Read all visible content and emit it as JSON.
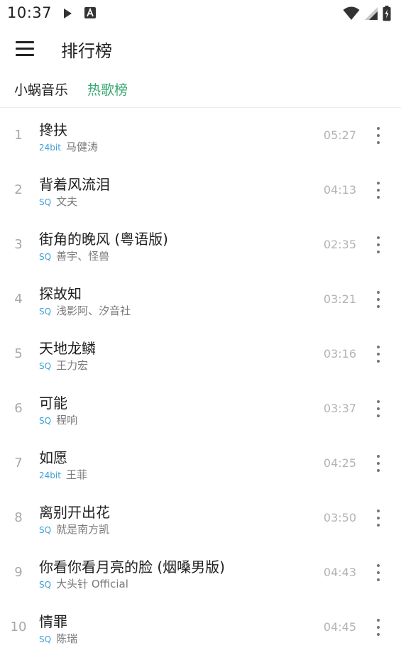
{
  "status_bar": {
    "time": "10:37",
    "icons": [
      "play-icon",
      "a-notification-icon",
      "wifi-icon",
      "signal-icon",
      "battery-icon"
    ]
  },
  "app_bar": {
    "menu_icon": "menu-icon",
    "title": "排行榜"
  },
  "tabs": {
    "source": "小蜗音乐",
    "active": "热歌榜",
    "active_color": "#3aa873"
  },
  "songs": [
    {
      "rank": "1",
      "title": "搀扶",
      "quality": "24bit",
      "artist": "马健涛",
      "duration": "05:27"
    },
    {
      "rank": "2",
      "title": "背着风流泪",
      "quality": "SQ",
      "artist": "文夫",
      "duration": "04:13"
    },
    {
      "rank": "3",
      "title": "街角的晚风 (粤语版)",
      "quality": "SQ",
      "artist": "善宇、怪兽",
      "duration": "02:35"
    },
    {
      "rank": "4",
      "title": "探故知",
      "quality": "SQ",
      "artist": "浅影阿、汐音社",
      "duration": "03:21"
    },
    {
      "rank": "5",
      "title": "天地龙鳞",
      "quality": "SQ",
      "artist": "王力宏",
      "duration": "03:16"
    },
    {
      "rank": "6",
      "title": "可能",
      "quality": "SQ",
      "artist": "程响",
      "duration": "03:37"
    },
    {
      "rank": "7",
      "title": "如愿",
      "quality": "24bit",
      "artist": "王菲",
      "duration": "04:25"
    },
    {
      "rank": "8",
      "title": "离别开出花",
      "quality": "SQ",
      "artist": "就是南方凯",
      "duration": "03:50"
    },
    {
      "rank": "9",
      "title": "你看你看月亮的脸 (烟嗓男版)",
      "quality": "SQ",
      "artist": "大头针 Official",
      "duration": "04:43"
    },
    {
      "rank": "10",
      "title": "情罪",
      "quality": "SQ",
      "artist": "陈瑞",
      "duration": "04:45"
    }
  ]
}
